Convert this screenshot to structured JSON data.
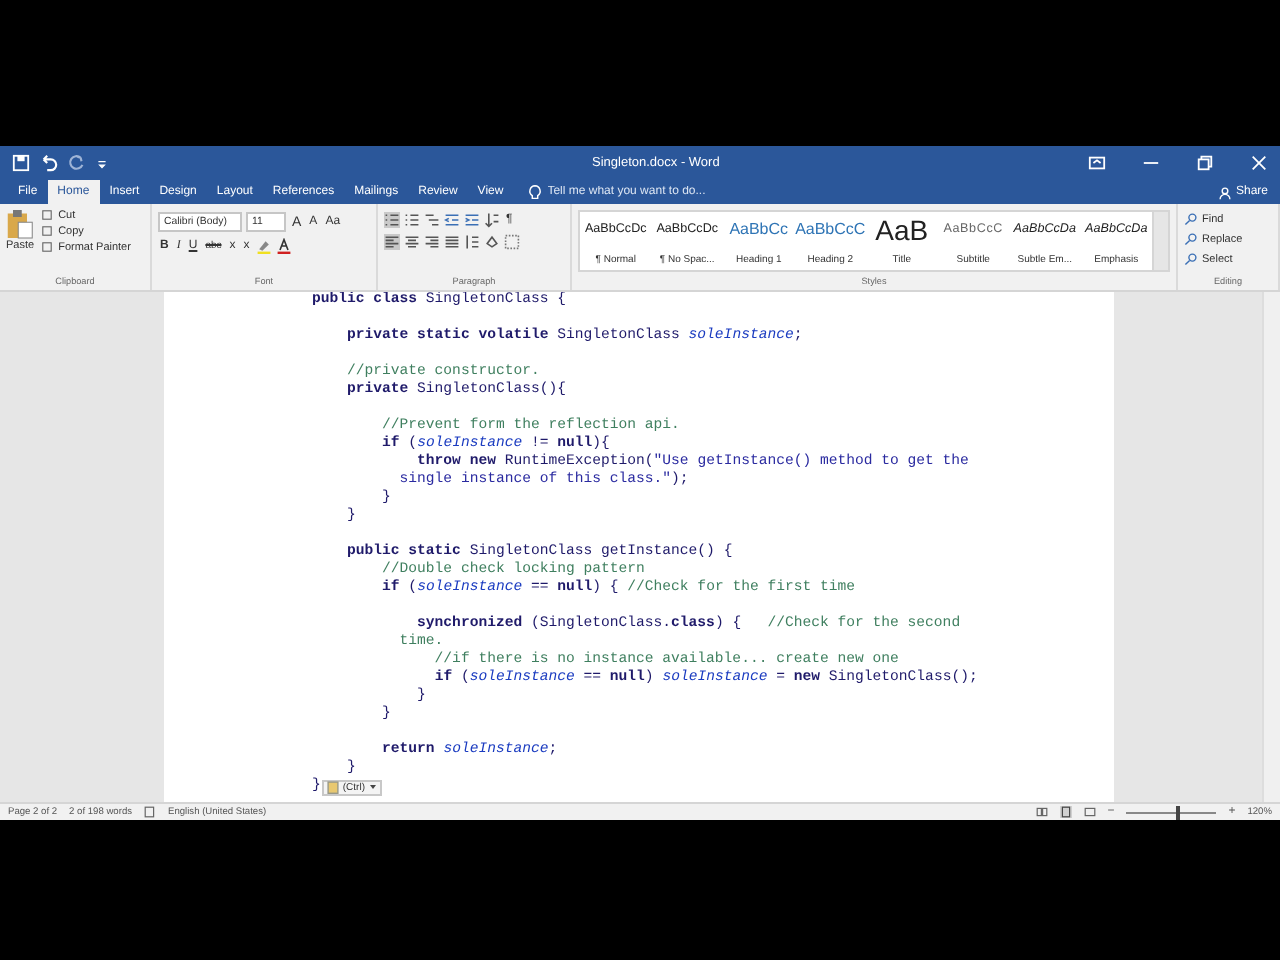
{
  "window": {
    "title": "Singleton.docx - Word"
  },
  "tabs": [
    {
      "label": "File",
      "selected": false
    },
    {
      "label": "Home",
      "selected": true
    },
    {
      "label": "Insert",
      "selected": false
    },
    {
      "label": "Design",
      "selected": false
    },
    {
      "label": "Layout",
      "selected": false
    },
    {
      "label": "References",
      "selected": false
    },
    {
      "label": "Mailings",
      "selected": false
    },
    {
      "label": "Review",
      "selected": false
    },
    {
      "label": "View",
      "selected": false
    }
  ],
  "tell_me": {
    "placeholder": "Tell me what you want to do..."
  },
  "share": "Share",
  "ribbon": {
    "clipboard": {
      "paste": "Paste",
      "items": [
        "Cut",
        "Copy",
        "Format Painter"
      ],
      "label": "Clipboard"
    },
    "font": {
      "name": "Calibri (Body)",
      "size": "11",
      "grow": "A",
      "shrink": "A",
      "case": "Aa",
      "bold": "B",
      "italic": "I",
      "underline": "U",
      "strike": "abc",
      "sub": "x",
      "sup": "x",
      "label": "Font"
    },
    "paragraph": {
      "label": "Paragraph",
      "pilcrow": "¶"
    },
    "styles": {
      "label": "Styles",
      "items": [
        {
          "preview": "AaBbCcDc",
          "name": "¶ Normal",
          "kind": "normal"
        },
        {
          "preview": "AaBbCcDc",
          "name": "¶ No Spac...",
          "kind": "normal"
        },
        {
          "preview": "AaBbCc",
          "name": "Heading 1",
          "kind": "heading"
        },
        {
          "preview": "AaBbCcC",
          "name": "Heading 2",
          "kind": "heading"
        },
        {
          "preview": "AaB",
          "name": "Title",
          "kind": "title"
        },
        {
          "preview": "AaBbCcC",
          "name": "Subtitle",
          "kind": "subtitle"
        },
        {
          "preview": "AaBbCcDa",
          "name": "Subtle Em...",
          "kind": "emphasis"
        },
        {
          "preview": "AaBbCcDa",
          "name": "Emphasis",
          "kind": "emphasis"
        }
      ]
    },
    "editing": {
      "label": "Editing",
      "items": [
        "Find",
        "Replace",
        "Select"
      ]
    }
  },
  "document": {
    "blocks": [
      [
        {
          "segments": [
            {
              "kind": "code",
              "text": "**public class** SingletonClass {"
            }
          ]
        }
      ],
      [
        {
          "segments": [
            {
              "kind": "code",
              "text": "    **private static volatile** SingletonClass "
            },
            {
              "kind": "field",
              "text": "soleInstance"
            },
            {
              "kind": "code",
              "text": ";"
            }
          ]
        }
      ],
      [
        {
          "segments": [
            {
              "kind": "comment",
              "text": "    //private constructor."
            }
          ]
        },
        {
          "segments": [
            {
              "kind": "code",
              "text": "    **private** SingletonClass(){"
            }
          ]
        }
      ],
      [
        {
          "segments": [
            {
              "kind": "comment",
              "text": "        //Prevent form the reflection api."
            }
          ]
        },
        {
          "segments": [
            {
              "kind": "code",
              "text": "        **if** ("
            },
            {
              "kind": "field",
              "text": "soleInstance"
            },
            {
              "kind": "code",
              "text": " != **null**){"
            }
          ]
        },
        {
          "segments": [
            {
              "kind": "code",
              "text": "            **throw new** RuntimeException("
            },
            {
              "kind": "string",
              "text": "\"Use getInstance() method to get the"
            }
          ]
        },
        {
          "segments": [
            {
              "kind": "string",
              "text": "          single instance of this class.\""
            },
            {
              "kind": "code",
              "text": ");"
            }
          ]
        },
        {
          "segments": [
            {
              "kind": "code",
              "text": "        }"
            }
          ]
        },
        {
          "segments": [
            {
              "kind": "code",
              "text": "    }"
            }
          ]
        }
      ],
      [
        {
          "segments": [
            {
              "kind": "code",
              "text": "    **public static** SingletonClass getInstance() {"
            }
          ]
        },
        {
          "segments": [
            {
              "kind": "comment",
              "text": "        //Double check locking pattern"
            }
          ]
        },
        {
          "segments": [
            {
              "kind": "code",
              "text": "        **if** ("
            },
            {
              "kind": "field",
              "text": "soleInstance"
            },
            {
              "kind": "code",
              "text": " == **null**) { "
            },
            {
              "kind": "comment",
              "text": "//Check for the first time"
            }
          ]
        }
      ],
      [
        {
          "segments": [
            {
              "kind": "code",
              "text": "            **synchronized** (SingletonClass.**class**) {   "
            },
            {
              "kind": "comment",
              "text": "//Check for the second"
            }
          ]
        },
        {
          "segments": [
            {
              "kind": "comment",
              "text": "          time."
            }
          ]
        },
        {
          "segments": [
            {
              "kind": "comment",
              "text": "              //if there is no instance available... create new one"
            }
          ]
        },
        {
          "segments": [
            {
              "kind": "code",
              "text": "              **if** ("
            },
            {
              "kind": "field",
              "text": "soleInstance"
            },
            {
              "kind": "code",
              "text": " == **null**) "
            },
            {
              "kind": "field",
              "text": "soleInstance"
            },
            {
              "kind": "code",
              "text": " = **new** SingletonClass();"
            }
          ]
        },
        {
          "segments": [
            {
              "kind": "code",
              "text": "            }"
            }
          ]
        },
        {
          "segments": [
            {
              "kind": "code",
              "text": "        }"
            }
          ]
        }
      ],
      [
        {
          "segments": [
            {
              "kind": "code",
              "text": "        **return** "
            },
            {
              "kind": "field",
              "text": "soleInstance"
            },
            {
              "kind": "code",
              "text": ";"
            }
          ]
        },
        {
          "segments": [
            {
              "kind": "code",
              "text": "    }"
            }
          ]
        },
        {
          "segments": [
            {
              "kind": "code",
              "text": "}"
            }
          ]
        }
      ]
    ],
    "paste_options": "(Ctrl)"
  },
  "status_bar": {
    "page": "Page 2 of 2",
    "words": "2 of 198 words",
    "language": "English (United States)",
    "zoom": {
      "out": "−",
      "level": 0.55,
      "in": "+",
      "reading": "120%"
    }
  }
}
